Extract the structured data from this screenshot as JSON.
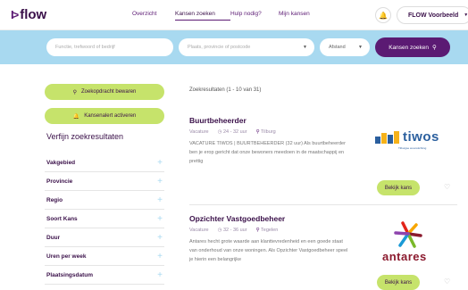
{
  "header": {
    "logo_mark": "I>",
    "logo_text": "flow",
    "nav": [
      "Overzicht",
      "Kansen zoeken",
      "Hulp nodig?",
      "Mijn kansen"
    ],
    "active_nav": "Kansen zoeken",
    "user_label": "FLOW Voorbeeld"
  },
  "search": {
    "keyword_placeholder": "Functie, trefwoord of bedrijf",
    "location_placeholder": "Plaats, provincie of postcode",
    "distance_label": "Afstand",
    "button_label": "Kansen zoeken"
  },
  "sidebar": {
    "save_button": "Zoekopdracht bewaren",
    "alert_button": "Kansenalert activeren",
    "refine_title": "Verfijn zoekresultaten",
    "filters": [
      "Vakgebied",
      "Provincie",
      "Regio",
      "Soort Kans",
      "Duur",
      "Uren per week",
      "Plaatsingsdatum"
    ]
  },
  "results": {
    "count_text": "Zoekresultaten (1 - 10 van 31)",
    "items": [
      {
        "title": "Buurtbeheerder",
        "type": "Vacature",
        "hours": "24 - 32 uur",
        "location": "Tilburg",
        "description": "VACATURE TIWOS | BUURTBEHEERDER (32 uur) Als buurtbeheerder ben je erop gericht dat onze bewoners meedoen in de maatschappij en prettig",
        "logo_text": "tiwos",
        "logo_sub": "Tilburgse woonstichting",
        "button": "Bekijk kans"
      },
      {
        "title": "Opzichter Vastgoedbeheer",
        "type": "Vacature",
        "hours": "32 - 36 uur",
        "location": "Tegelen",
        "description": "Antares hecht grote waarde aan klanttevredenheid en een goede staat van onderhoud van onze woningen. Als Opzichter Vastgoedbeheer speel je hierin een belangrijke",
        "logo_text": "antares",
        "button": "Bekijk kans"
      }
    ]
  },
  "colors": {
    "brand_purple": "#5b1a73",
    "accent_green": "#c6e36b",
    "search_band": "#a8d9f0"
  }
}
